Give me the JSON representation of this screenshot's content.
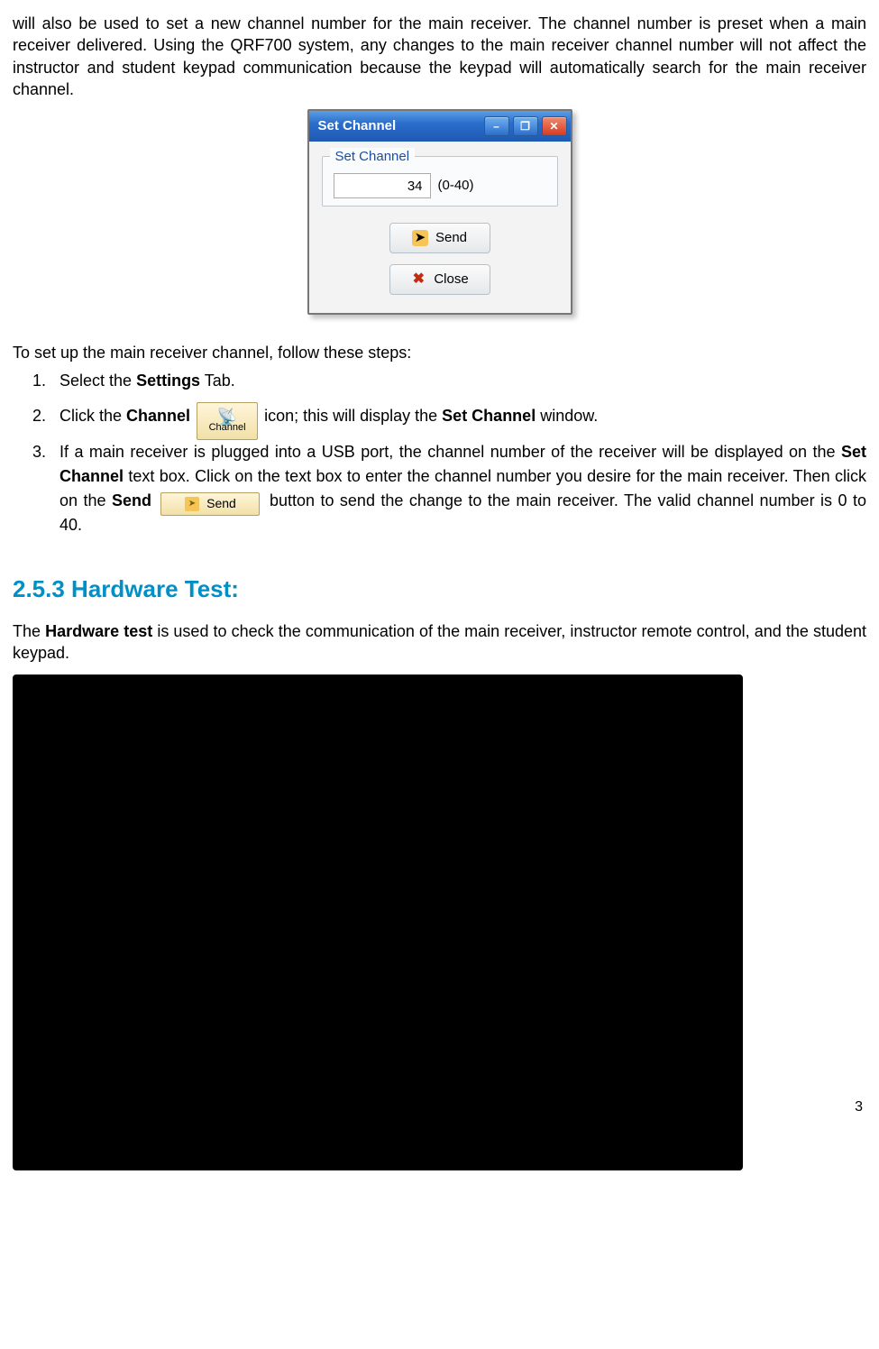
{
  "intro_paragraph": "will also be used to set a new channel number for the main receiver. The channel number is preset when a main receiver delivered. Using the QRF700 system, any changes to the main receiver channel number will not affect the instructor and student keypad communication because the keypad will automatically search for the main receiver channel.",
  "set_channel_window": {
    "title": "Set Channel",
    "group_label": "Set Channel",
    "channel_value": "34",
    "range_text": "(0-40)",
    "send_label": "Send",
    "close_label": "Close",
    "minimize_glyph": "–",
    "restore_glyph": "❐",
    "closewin_glyph": "✕"
  },
  "steps_lead": "To set up the main receiver channel, follow these steps:",
  "step1_prefix": "Select the ",
  "step1_bold": "Settings",
  "step1_suffix": " Tab.",
  "step2_prefix": "Click the ",
  "step2_bold": "Channel",
  "step2_chip_label": "Channel",
  "step2_mid": "icon; this will display the ",
  "step2_bold2": "Set Channel",
  "step2_suffix": " window.",
  "step3_a": "If a main receiver is plugged into a USB port, the channel number of the receiver will be displayed on the ",
  "step3_bold1": "Set Channel",
  "step3_b": " text box. Click on the text box to enter the channel number you desire for the main receiver. Then click on the ",
  "step3_bold2": "Send",
  "step3_chip_send": "Send",
  "step3_c": " button to send the change to the main receiver. The valid channel number is 0 to 40.",
  "section_heading": "2.5.3 Hardware Test:",
  "hw_prefix": "The ",
  "hw_bold": "Hardware test",
  "hw_rest": " is used to check the communication of the main receiver, instructor remote control, and the student keypad.",
  "page_partial": "3"
}
